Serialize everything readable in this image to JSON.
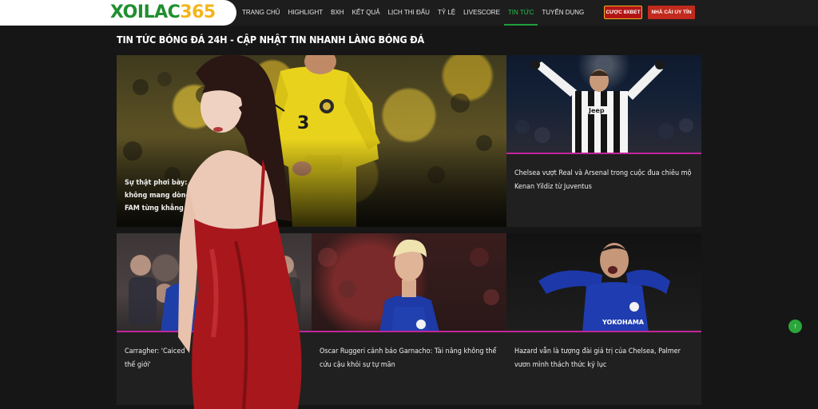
{
  "header": {
    "logo_part1": "XOILAC",
    "logo_part2": "365",
    "nav": [
      {
        "label": "TRANG CHỦ",
        "active": false
      },
      {
        "label": "HIGHLIGHT",
        "active": false
      },
      {
        "label": "BXH",
        "active": false
      },
      {
        "label": "KẾT QUẢ",
        "active": false
      },
      {
        "label": "LỊCH THI ĐẤU",
        "active": false
      },
      {
        "label": "TỶ LỆ",
        "active": false
      },
      {
        "label": "LIVESCORE",
        "active": false
      },
      {
        "label": "TIN TỨC",
        "active": true
      },
      {
        "label": "TUYỂN DỤNG",
        "active": false
      }
    ],
    "cta_bet": "CƯỢC 8XBET",
    "cta_trust": "NHÀ CÁI UY TÍN"
  },
  "page_title": "TIN TỨC BÓNG ĐÁ 24H - CẬP NHẬT TIN NHANH LÀNG BÓNG ĐÁ",
  "featured": {
    "title_lines": [
      "Sự thật phơi bày: ra",
      "không mang dòng",
      "FAM từng khẳng"
    ],
    "player_number": "3"
  },
  "articles": [
    {
      "title": "Chelsea vượt Real và Arsenal trong cuộc đua chiêu mộ Kenan Yildiz từ Juventus"
    },
    {
      "title": "Carragher: 'Caiced",
      "title_line2": "thế giới'"
    },
    {
      "title": "Oscar Ruggeri cảnh báo Garnacho: Tài năng không thể cứu cậu khỏi sự tự mãn"
    },
    {
      "title": "Hazard vẫn là tượng đài giá trị của Chelsea, Palmer vươn mình thách thức kỷ lục"
    }
  ],
  "jersey_texts": {
    "juventus": "Jeep",
    "chelsea": "YOKOHAMA"
  },
  "colors": {
    "brand_green": "#1f8f2f",
    "brand_gold": "#f3b51a",
    "accent_active": "#27c24c",
    "cta_red": "#b31515",
    "card_bg": "#202020",
    "pink_line": "#c1269b"
  },
  "icons": {
    "back_to_top": "arrow-up-icon"
  },
  "back_to_top_glyph": "↑"
}
